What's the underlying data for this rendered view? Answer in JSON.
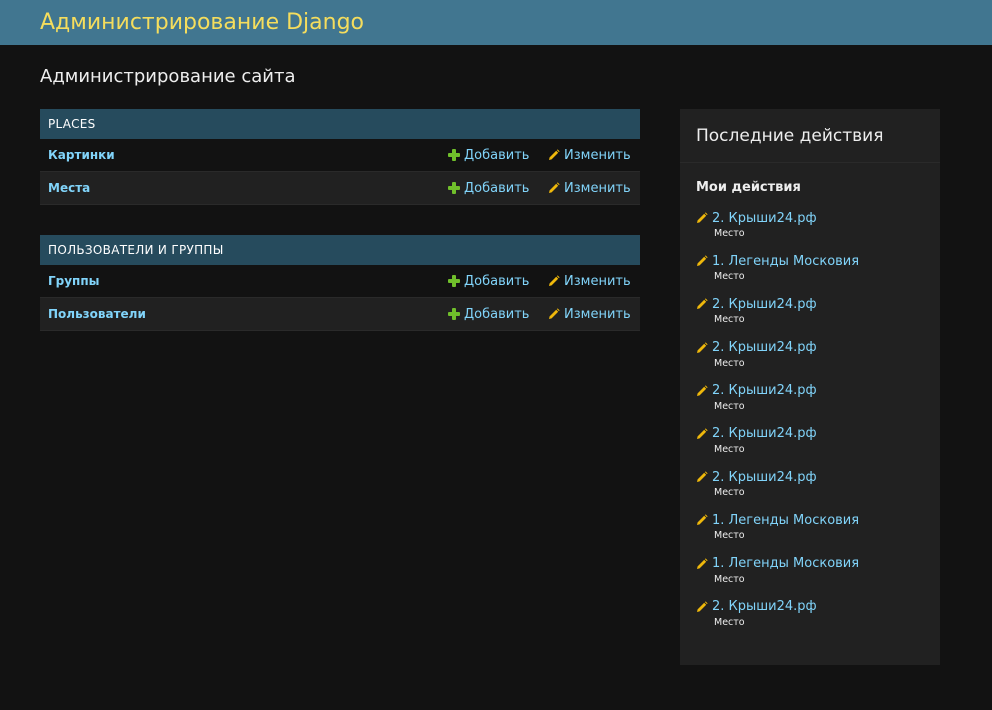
{
  "header": {
    "brand": "Администрирование Django"
  },
  "page_title": "Администрирование сайта",
  "modules": [
    {
      "caption": "PLACES",
      "models": [
        {
          "name": "Картинки",
          "add_label": "Добавить",
          "change_label": "Изменить"
        },
        {
          "name": "Места",
          "add_label": "Добавить",
          "change_label": "Изменить"
        }
      ]
    },
    {
      "caption": "ПОЛЬЗОВАТЕЛИ И ГРУППЫ",
      "models": [
        {
          "name": "Группы",
          "add_label": "Добавить",
          "change_label": "Изменить"
        },
        {
          "name": "Пользователи",
          "add_label": "Добавить",
          "change_label": "Изменить"
        }
      ]
    }
  ],
  "sidebar": {
    "title": "Последние действия",
    "subtitle": "Мои действия",
    "actions": [
      {
        "label": "2. Крыши24.рф",
        "type": "Место"
      },
      {
        "label": "1. Легенды Московия",
        "type": "Место"
      },
      {
        "label": "2. Крыши24.рф",
        "type": "Место"
      },
      {
        "label": "2. Крыши24.рф",
        "type": "Место"
      },
      {
        "label": "2. Крыши24.рф",
        "type": "Место"
      },
      {
        "label": "2. Крыши24.рф",
        "type": "Место"
      },
      {
        "label": "2. Крыши24.рф",
        "type": "Место"
      },
      {
        "label": "1. Легенды Московия",
        "type": "Место"
      },
      {
        "label": "1. Легенды Московия",
        "type": "Место"
      },
      {
        "label": "2. Крыши24.рф",
        "type": "Место"
      }
    ]
  },
  "colors": {
    "header_bg": "#417690",
    "brand": "#f5dd5d",
    "caption_bg": "#264b5d",
    "link": "#81d4fa",
    "add_icon": "#70bf2b",
    "change_icon": "#efb80b",
    "page_bg": "#121212",
    "sidebar_bg": "#212121"
  },
  "icons": {
    "add": "plus-icon",
    "change": "pencil-icon"
  }
}
